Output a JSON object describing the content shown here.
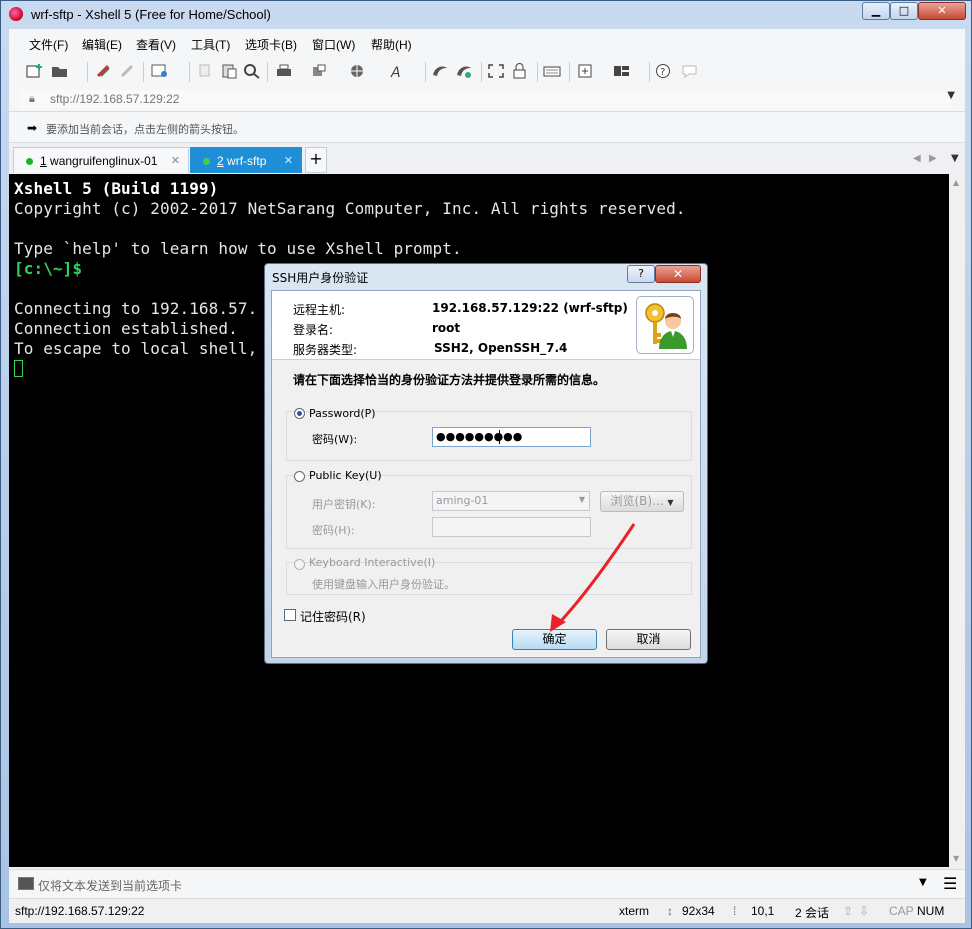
{
  "window": {
    "title": "wrf-sftp - Xshell 5 (Free for Home/School)",
    "minimize": "▁",
    "maximize": "□",
    "close": "✕"
  },
  "menu": [
    "文件(F)",
    "编辑(E)",
    "查看(V)",
    "工具(T)",
    "选项卡(B)",
    "窗口(W)",
    "帮助(H)"
  ],
  "address": {
    "value": "sftp://192.168.57.129:22"
  },
  "hint": {
    "text": "要添加当前会话，点击左侧的箭头按钮。"
  },
  "tabs": [
    {
      "num": "1",
      "label": "wangruifenglinux-01"
    },
    {
      "num": "2",
      "label": "wrf-sftp"
    }
  ],
  "terminal": {
    "lines": [
      "Xshell 5 (Build 1199)",
      "Copyright (c) 2002-2017 NetSarang Computer, Inc. All rights reserved.",
      "",
      "Type `help' to learn how to use Xshell prompt.",
      "[c:\\~]$",
      "",
      "Connecting to 192.168.57.",
      "Connection established.",
      "To escape to local shell,"
    ]
  },
  "dialog": {
    "title": "SSH用户身份验证",
    "help": "?",
    "close": "✕",
    "remote_host_label": "远程主机:",
    "remote_host": "192.168.57.129:22 (wrf-sftp)",
    "login_label": "登录名:",
    "login": "root",
    "server_type_label": "服务器类型:",
    "server_type": "SSH2, OpenSSH_7.4",
    "instruction": "请在下面选择恰当的身份验证方法并提供登录所需的信息。",
    "password_option": "Password(P)",
    "password_field_label": "密码(W):",
    "password_value": "●●●●●●●●●",
    "publickey_option": "Public Key(U)",
    "user_key_label": "用户密钥(K):",
    "user_key_value": "aming-01",
    "browse_button": "浏览(B)...",
    "passphrase_label": "密码(H):",
    "keyboard_option": "Keyboard Interactive(I)",
    "keyboard_desc": "使用键盘输入用户身份验证。",
    "remember_label": "记住密码(R)",
    "ok_button": "确定",
    "cancel_button": "取消"
  },
  "input_bar": {
    "text": "仅将文本发送到当前选项卡"
  },
  "status": {
    "address": "sftp://192.168.57.129:22",
    "term": "xterm",
    "size": "92x34",
    "pos": "10,1",
    "sessions": "2 会话",
    "cap": "CAP",
    "num": "NUM"
  },
  "colors": {
    "terminal_bg": "#000000",
    "prompt_green": "#31d35b",
    "active_tab": "#1e8fd6",
    "annotation_arrow": "#e8232a"
  }
}
